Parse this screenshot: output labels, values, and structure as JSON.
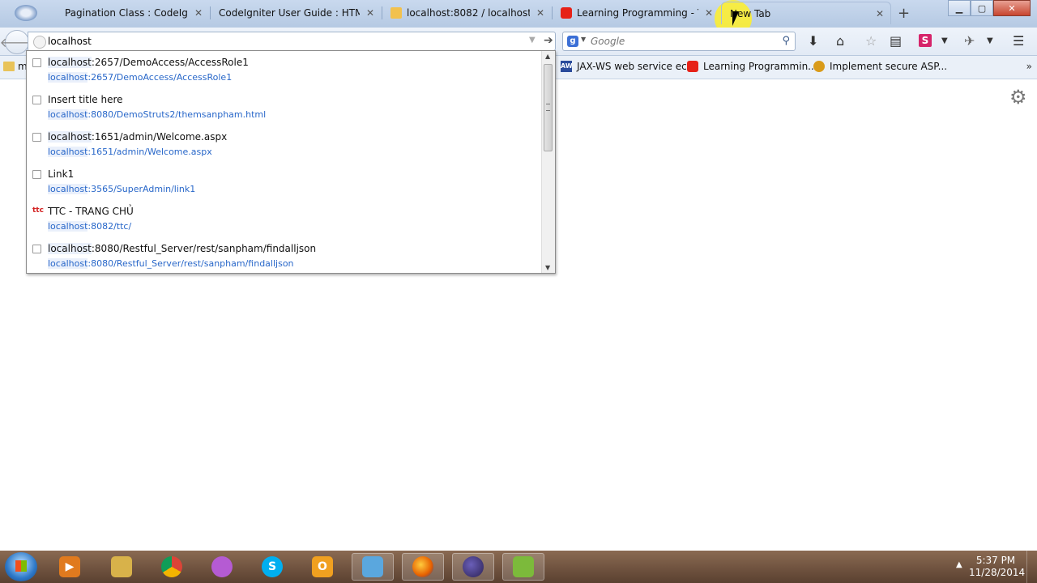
{
  "browser": {
    "tabs": [
      {
        "label": "Pagination Class : CodeIgniter ...",
        "favicon": "eye-icon"
      },
      {
        "label": "CodeIgniter User Guide : HTML...",
        "favicon": "none"
      },
      {
        "label": "localhost:8082 / localhost /...",
        "favicon": "phpmyadmin-icon"
      },
      {
        "label": "Learning Programming - Y...",
        "favicon": "youtube-icon"
      },
      {
        "label": "New Tab",
        "favicon": "none",
        "active": true
      }
    ],
    "tab_close_glyph": "✕",
    "new_tab_glyph": "+",
    "window_controls": {
      "minimize": "▁",
      "maximize": "▢",
      "close": "✕"
    }
  },
  "navbar": {
    "url_value": "localhost",
    "search_placeholder": "Google",
    "search_engine_glyph": "g"
  },
  "bookmarks": {
    "items": [
      {
        "label": "m",
        "icon": "folder-icon"
      },
      {
        "label": "JAX-WS web service ec...",
        "icon": "aw-icon"
      },
      {
        "label": "Learning Programmin...",
        "icon": "youtube-icon"
      },
      {
        "label": "Implement secure ASP...",
        "icon": "medal-icon"
      }
    ],
    "overflow_glyph": "»"
  },
  "autocomplete": {
    "items": [
      {
        "match": "localhost",
        "title_rest": ":2657/DemoAccess/AccessRole1",
        "url_match": "localhost",
        "url_rest": ":2657/DemoAccess/AccessRole1",
        "favicon": "page"
      },
      {
        "match": "",
        "title_rest": "Insert title here",
        "url_match": "localhost",
        "url_rest": ":8080/DemoStruts2/themsanpham.html",
        "favicon": "page"
      },
      {
        "match": "localhost",
        "title_rest": ":1651/admin/Welcome.aspx",
        "url_match": "localhost",
        "url_rest": ":1651/admin/Welcome.aspx",
        "favicon": "page"
      },
      {
        "match": "",
        "title_rest": "Link1",
        "url_match": "localhost",
        "url_rest": ":3565/SuperAdmin/link1",
        "favicon": "page"
      },
      {
        "match": "",
        "title_rest": "TTC - TRANG CHỦ",
        "url_match": "localhost",
        "url_rest": ":8082/ttc/",
        "favicon": "ttc"
      },
      {
        "match": "localhost",
        "title_rest": ":8080/Restful_Server/rest/sanpham/findalljson",
        "url_match": "localhost",
        "url_rest": ":8080/Restful_Server/rest/sanpham/findalljson",
        "favicon": "page"
      }
    ],
    "ttc_favicon_text": "ttc"
  },
  "taskbar": {
    "apps": [
      {
        "icon": "media-player-icon",
        "color": "#e07a1e"
      },
      {
        "icon": "file-explorer-icon",
        "color": "#d8b24a"
      },
      {
        "icon": "chrome-icon",
        "color": "#3aa757"
      },
      {
        "icon": "messenger-icon",
        "color": "#b55bd3"
      },
      {
        "icon": "skype-icon",
        "color": "#00aff0"
      },
      {
        "icon": "outlook-icon",
        "color": "#f0a020"
      },
      {
        "icon": "windows-explorer-icon",
        "color": "#5aa7de"
      },
      {
        "icon": "firefox-icon",
        "color": "#e66000"
      },
      {
        "icon": "eclipse-icon",
        "color": "#2c2255"
      },
      {
        "icon": "notepadpp-icon",
        "color": "#7cba3b"
      }
    ],
    "clock_time": "5:37 PM",
    "clock_date": "11/28/2014"
  }
}
